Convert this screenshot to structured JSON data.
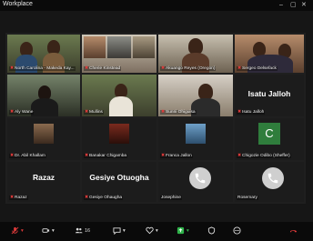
{
  "window": {
    "title": "Workplace",
    "min": "–",
    "max": "▢",
    "close": "✕"
  },
  "tiles": {
    "row1": [
      {
        "name": "North Carolina - Makeda Kay..."
      },
      {
        "name": "Cherie Kinstead"
      },
      {
        "name": "Akuango Reyes (Oregon)"
      },
      {
        "name": "Sergeo Delsefack"
      }
    ],
    "row2": [
      {
        "name": "Aly Wane"
      },
      {
        "name": "Mullins"
      },
      {
        "name": "Sunni Ohiguisa"
      },
      {
        "name": "Isatu Jalloh",
        "display": "Isatu Jalloh"
      }
    ],
    "row3": [
      {
        "name": "Dr. Abil Khallam"
      },
      {
        "name": "Banakar Chigamba"
      },
      {
        "name": "Franca Jallon"
      },
      {
        "name": "Chigozie Odibo (Sheffer)",
        "initial": "C"
      }
    ],
    "row4": [
      {
        "name": "Razaz",
        "display": "Razaz"
      },
      {
        "name": "Gesiye Ohaugha",
        "display": "Gesiye Otuogha"
      },
      {
        "name": "Josephine"
      },
      {
        "name": "Rosemary"
      }
    ]
  },
  "toolbar": {
    "participants_count": "16"
  },
  "colors": {
    "mute_red": "#e23b3b",
    "avatar_green": "#2f7d3c",
    "share_green": "#2fb34a"
  }
}
